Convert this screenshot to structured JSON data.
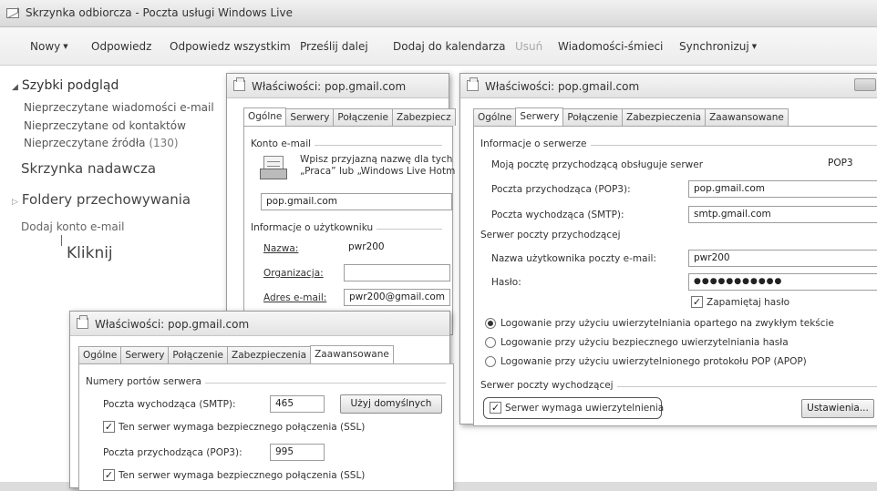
{
  "window": {
    "title": "Skrzynka odbiorcza - Poczta usługi Windows Live"
  },
  "toolbar": {
    "new": "Nowy",
    "reply": "Odpowiedz",
    "reply_all": "Odpowiedz wszystkim",
    "forward": "Prześlij dalej",
    "add_calendar": "Dodaj do kalendarza",
    "delete": "Usuń",
    "junk": "Wiadomości-śmieci",
    "sync": "Synchronizuj"
  },
  "nav": {
    "quick_view": "Szybki podgląd",
    "unread_mail": "Nieprzeczytane wiadomości e-mail",
    "unread_contacts": "Nieprzeczytane od kontaktów",
    "unread_feeds": "Nieprzeczytane źródła",
    "unread_feeds_count": "(130)",
    "outbox": "Skrzynka nadawcza",
    "storage_folders": "Foldery przechowywania",
    "add_account": "Dodaj konto e-mail",
    "annotation": "Kliknij"
  },
  "dialog_general": {
    "title": "Właściwości: pop.gmail.com",
    "tabs": [
      "Ogólne",
      "Serwery",
      "Połączenie",
      "Zabezpiecz"
    ],
    "account_group": "Konto e-mail",
    "account_desc_1": "Wpisz przyjazną nazwę dla tych",
    "account_desc_2": "„Praca” lub „Windows Live Hotm",
    "account_name": "pop.gmail.com",
    "user_group": "Informacje o użytkowniku",
    "name_label": "Nazwa:",
    "name_value": "pwr200",
    "org_label": "Organizacja:",
    "org_value": "",
    "email_label": "Adres e-mail:",
    "email_value": "pwr200@gmail.com"
  },
  "dialog_servers": {
    "title": "Właściwości: pop.gmail.com",
    "tabs": [
      "Ogólne",
      "Serwery",
      "Połączenie",
      "Zabezpieczenia",
      "Zaawansowane"
    ],
    "server_info_group": "Informacje o serwerze",
    "incoming_type_label": "Moją pocztę przychodzącą obsługuje serwer",
    "incoming_type_value": "POP3",
    "pop3_label": "Poczta przychodząca (POP3):",
    "pop3_value": "pop.gmail.com",
    "smtp_label": "Poczta wychodząca (SMTP):",
    "smtp_value": "smtp.gmail.com",
    "incoming_group": "Serwer poczty przychodzącej",
    "username_label": "Nazwa użytkownika poczty e-mail:",
    "username_value": "pwr200",
    "password_label": "Hasło:",
    "password_value": "●●●●●●●●●●●",
    "remember_password": "Zapamiętaj hasło",
    "auth_plain": "Logowanie przy użyciu uwierzytelniania opartego na zwykłym tekście",
    "auth_secure": "Logowanie przy użyciu bezpiecznego uwierzytelniania hasła",
    "auth_apop": "Logowanie przy użyciu uwierzytelnionego protokołu POP (APOP)",
    "outgoing_group": "Serwer poczty wychodzącej",
    "requires_auth": "Serwer wymaga uwierzytelnienia",
    "settings_button": "Ustawienia..."
  },
  "dialog_advanced": {
    "title": "Właściwości: pop.gmail.com",
    "tabs": [
      "Ogólne",
      "Serwery",
      "Połączenie",
      "Zabezpieczenia",
      "Zaawansowane"
    ],
    "ports_group": "Numery portów serwera",
    "smtp_label": "Poczta wychodząca (SMTP):",
    "smtp_port": "465",
    "use_defaults": "Użyj domyślnych",
    "smtp_ssl": "Ten serwer wymaga bezpiecznego połączenia (SSL)",
    "pop3_label": "Poczta przychodząca (POP3):",
    "pop3_port": "995",
    "pop3_ssl": "Ten serwer wymaga bezpiecznego połączenia (SSL)"
  }
}
